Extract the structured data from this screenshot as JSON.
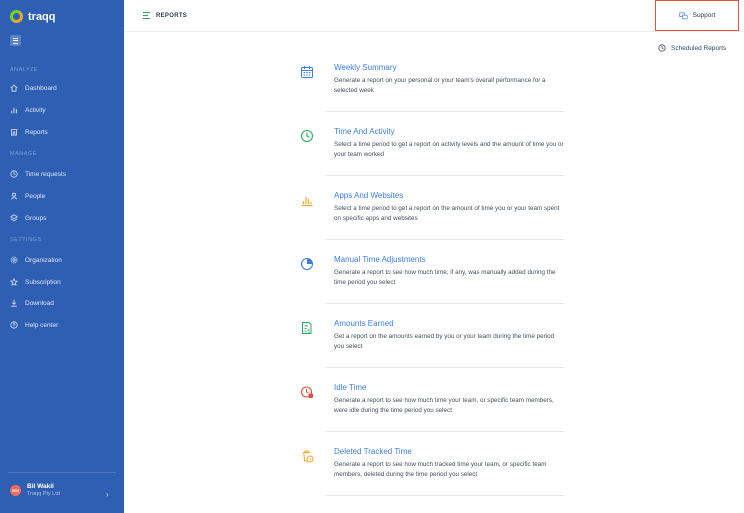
{
  "sidebar": {
    "brand": "traqq",
    "sections": {
      "analyze": "ANALYZE",
      "manage": "MANAGE",
      "settings": "SETTINGS"
    },
    "items": [
      {
        "label": "Dashboard",
        "icon": "home-icon"
      },
      {
        "label": "Activity",
        "icon": "bar-chart-icon"
      },
      {
        "label": "Reports",
        "icon": "reports-icon"
      },
      {
        "label": "Time requests",
        "icon": "clock-icon"
      },
      {
        "label": "People",
        "icon": "people-icon"
      },
      {
        "label": "Groups",
        "icon": "groups-icon"
      },
      {
        "label": "Organization",
        "icon": "gear-icon"
      },
      {
        "label": "Subscription",
        "icon": "star-icon"
      },
      {
        "label": "Download",
        "icon": "download-icon"
      },
      {
        "label": "Help center",
        "icon": "help-icon"
      }
    ],
    "user": {
      "initials": "BW",
      "name": "Bil Wakil",
      "org": "Traqq Pty Ltd"
    }
  },
  "header": {
    "title": "REPORTS",
    "support_label": "Support",
    "scheduled_label": "Scheduled Reports"
  },
  "reports": [
    {
      "title": "Weekly Summary",
      "desc": "Generate a report on your personal or your team's overall performance for a selected week",
      "icon": "calendar-icon"
    },
    {
      "title": "Time And Activity",
      "desc": "Select a time period to get a report on activity levels and the amount of time you or your team worked",
      "icon": "clock-icon"
    },
    {
      "title": "Apps And Websites",
      "desc": "Select a time period to get a report on the amount of time you or your team spent on specific apps and websites",
      "icon": "bar-chart-icon"
    },
    {
      "title": "Manual Time Adjustments",
      "desc": "Generate a report to see how much time, if any, was manually added during the time period you select",
      "icon": "pie-chart-icon"
    },
    {
      "title": "Amounts Earned",
      "desc": "Get a report on the amounts earned by you or your team during the time period you select",
      "icon": "money-document-icon"
    },
    {
      "title": "Idle Time",
      "desc": "Generate a report to see how much time your team, or specific team members, were idle during the time period you select",
      "icon": "idle-clock-icon"
    },
    {
      "title": "Deleted Tracked Time",
      "desc": "Generate a report to see how much tracked time your team, or specific team members, deleted during the time period you select",
      "icon": "deleted-time-icon"
    }
  ],
  "colors": {
    "sidebar": "#2f5fb3",
    "link": "#3d7ee0",
    "highlight": "#e8513b"
  }
}
